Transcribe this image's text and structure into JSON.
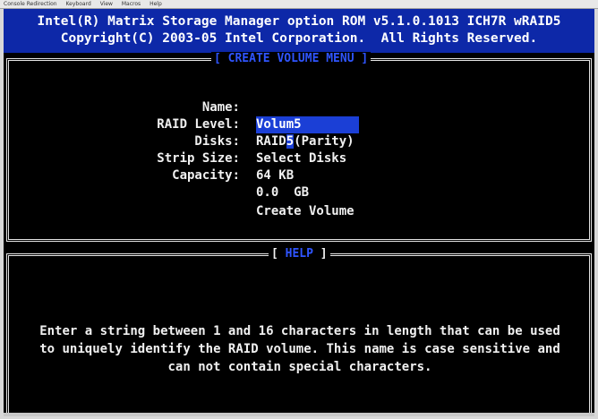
{
  "menubar": {
    "items": [
      "Console Redirection",
      "Keyboard",
      "View",
      "Macros",
      "Help"
    ]
  },
  "banner": {
    "line1": "Intel(R) Matrix Storage Manager option ROM v5.1.0.1013 ICH7R wRAID5",
    "line2": "Copyright(C) 2003-05 Intel Corporation.  All Rights Reserved."
  },
  "create_menu": {
    "title": "[ CREATE VOLUME MENU ]",
    "fields": [
      {
        "label": "Name:",
        "value": "Volum5"
      },
      {
        "label": "RAID Level:",
        "value_pre": "RAID",
        "value_hl": "5",
        "value_post": "(Parity)"
      },
      {
        "label": "Disks:",
        "value": "Select Disks"
      },
      {
        "label": "Strip Size:",
        "value": "64 KB"
      },
      {
        "label": "Capacity:",
        "value": "0.0  GB"
      }
    ],
    "action": "Create Volume"
  },
  "help": {
    "title_open": "[ ",
    "title_text": "HELP",
    "title_close": " ]",
    "lines": [
      "Enter a string between 1 and 16 characters in length that can be used",
      "to uniquely identify the RAID volume. This name is case sensitive and",
      "can not contain special characters."
    ]
  },
  "colors": {
    "banner": "#0d28a8",
    "highlight": "#1b3fd6",
    "text": "#f0f0f0",
    "title": "#2f55ff"
  }
}
